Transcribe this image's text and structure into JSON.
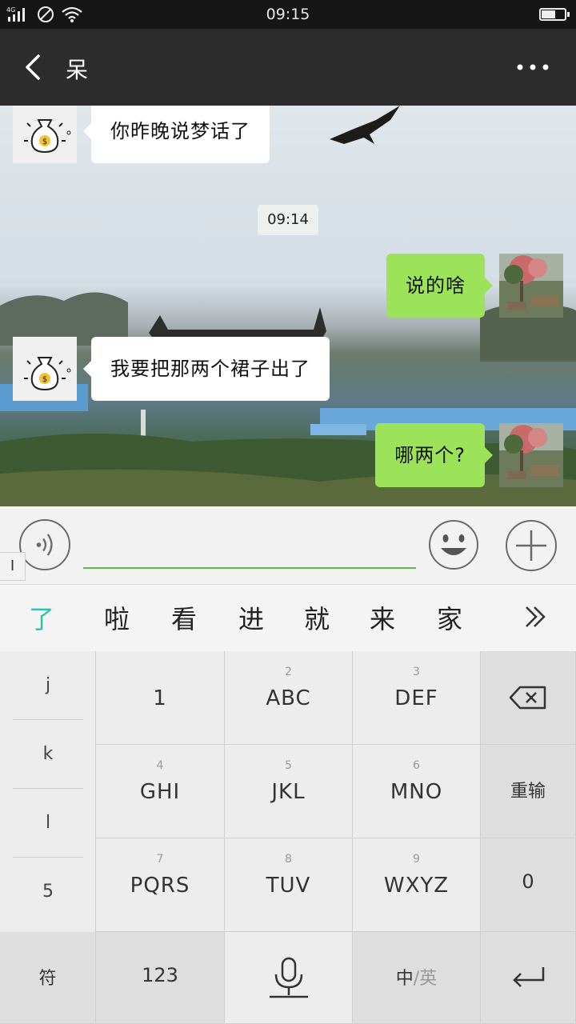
{
  "status_bar": {
    "network": "4G",
    "time": "09:15",
    "battery_level": 0.6
  },
  "header": {
    "title": "呆"
  },
  "chat": {
    "messages": [
      {
        "side": "in",
        "text": "你昨晚说梦话了"
      },
      {
        "side": "time",
        "text": "09:14"
      },
      {
        "side": "out",
        "text": "说的啥"
      },
      {
        "side": "in",
        "text": "我要把那两个裙子出了"
      },
      {
        "side": "out",
        "text": "哪两个?"
      }
    ]
  },
  "input": {
    "value": "",
    "placeholder": ""
  },
  "cursor_tab": "I",
  "candidates": [
    "了",
    "啦",
    "看",
    "进",
    "就",
    "来",
    "家"
  ],
  "keyboard": {
    "side_keys": [
      "j",
      "k",
      "l",
      "5"
    ],
    "keys": [
      {
        "sub": "",
        "main": "1"
      },
      {
        "sub": "2",
        "main": "ABC"
      },
      {
        "sub": "3",
        "main": "DEF"
      },
      {
        "sub": "4",
        "main": "GHI"
      },
      {
        "sub": "5",
        "main": "JKL"
      },
      {
        "sub": "6",
        "main": "MNO"
      },
      {
        "sub": "7",
        "main": "PQRS"
      },
      {
        "sub": "8",
        "main": "TUV"
      },
      {
        "sub": "9",
        "main": "WXYZ"
      }
    ],
    "reenter_label": "重输",
    "zero_label": "0",
    "symbol_label": "符",
    "num_label": "123",
    "lang_zh": "中",
    "lang_sep": "/",
    "lang_en": "英"
  },
  "colors": {
    "accent_green": "#9de35a",
    "input_underline": "#55c04a",
    "candidate_highlight": "#2ec4a8"
  },
  "icons": [
    "signal-icon",
    "no-disturb-icon",
    "wifi-icon",
    "battery-icon",
    "back-icon",
    "more-icon",
    "voice-icon",
    "emoji-icon",
    "plus-icon",
    "expand-icon",
    "backspace-icon",
    "mic-icon",
    "enter-icon"
  ]
}
